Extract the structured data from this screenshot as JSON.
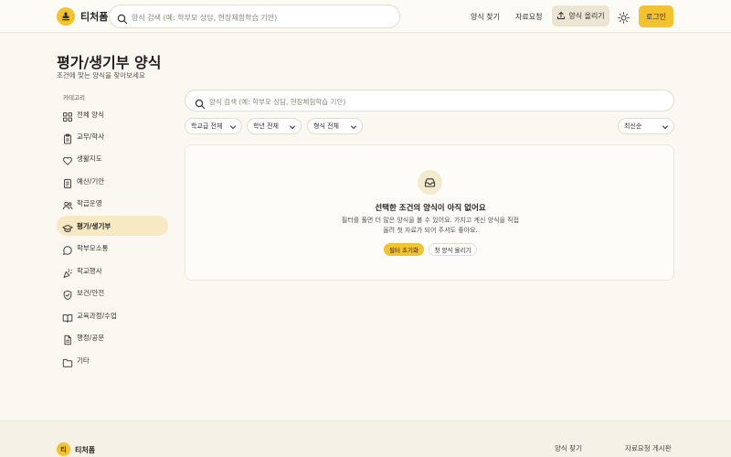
{
  "header": {
    "brand": "티처폼",
    "search_placeholder": "양식 검색 (예: 학부모 상담, 현장체험학습 기안)",
    "nav": [
      "양식 찾기",
      "자료요청"
    ],
    "upload_label": "양식 올리기",
    "login_label": "로그인"
  },
  "page": {
    "title": "평가/생기부 양식",
    "subtitle": "조건에 맞는 양식을 찾아보세요"
  },
  "sidebar": {
    "heading": "카테고리",
    "items": [
      {
        "label": "전체 양식",
        "icon": "grid-icon"
      },
      {
        "label": "교무/학사",
        "icon": "clipboard-icon"
      },
      {
        "label": "생활지도",
        "icon": "heart-icon"
      },
      {
        "label": "예산/기안",
        "icon": "receipt-icon"
      },
      {
        "label": "학급운영",
        "icon": "users-icon"
      },
      {
        "label": "평가/생기부",
        "icon": "graduation-cap-icon",
        "active": true
      },
      {
        "label": "학부모소통",
        "icon": "chat-icon"
      },
      {
        "label": "학교행사",
        "icon": "party-icon"
      },
      {
        "label": "보건/안전",
        "icon": "shield-icon"
      },
      {
        "label": "교육과정/수업",
        "icon": "book-icon"
      },
      {
        "label": "행정/공문",
        "icon": "document-icon"
      },
      {
        "label": "기타",
        "icon": "folder-icon"
      }
    ]
  },
  "main": {
    "search_placeholder": "양식 검색 (예: 학부모 상담, 현장체험학습 기안)",
    "filters": {
      "school_level": "학교급 전체",
      "grade": "학년 전체",
      "format": "형식 전체",
      "sort": "최신순"
    },
    "empty": {
      "title": "선택한 조건의 양식이 아직 없어요",
      "desc_line1": "필터를 풀면 더 많은 양식을 볼 수 있어요. 가지고 계신 양식을 직접",
      "desc_line2": "올려 첫 자료가 되어 주셔도 좋아요.",
      "reset_label": "필터 초기화",
      "upload_first_label": "첫 양식 올리기"
    }
  },
  "footer": {
    "badge": "티",
    "brand": "티처폼",
    "links": [
      "양식 찾기",
      "자료요청 게시판"
    ]
  },
  "colors": {
    "accent": "#f2c230",
    "background": "#fbf8f1",
    "active_item": "#f7e9c2"
  }
}
